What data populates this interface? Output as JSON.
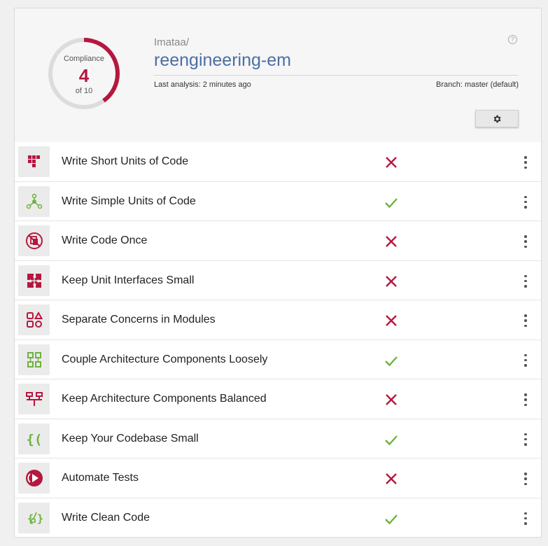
{
  "colors": {
    "fail": "#b5173f",
    "pass": "#6cb33e",
    "repo": "#4a6fa5"
  },
  "compliance": {
    "title": "Compliance",
    "value": "4",
    "of": "of 10",
    "fraction": 0.4
  },
  "repo": {
    "owner": "Imataa/",
    "name": "reengineering-em",
    "last_analysis": "Last analysis: 2 minutes ago",
    "branch": "Branch: master (default)",
    "help_glyph": "?"
  },
  "settings_button": {
    "icon": "gear-icon"
  },
  "guidelines": [
    {
      "label": "Write Short Units of Code",
      "icon": "short-units-icon",
      "status": "fail"
    },
    {
      "label": "Write Simple Units of Code",
      "icon": "simple-units-icon",
      "status": "pass"
    },
    {
      "label": "Write Code Once",
      "icon": "code-once-icon",
      "status": "fail"
    },
    {
      "label": "Keep Unit Interfaces Small",
      "icon": "puzzle-icon",
      "status": "fail"
    },
    {
      "label": "Separate Concerns in Modules",
      "icon": "modules-icon",
      "status": "fail"
    },
    {
      "label": "Couple Architecture Components Loosely",
      "icon": "loose-components-icon",
      "status": "pass"
    },
    {
      "label": "Keep Architecture Components Balanced",
      "icon": "balanced-components-icon",
      "status": "fail"
    },
    {
      "label": "Keep Your Codebase Small",
      "icon": "braces-icon",
      "status": "pass"
    },
    {
      "label": "Automate Tests",
      "icon": "play-icon",
      "status": "fail"
    },
    {
      "label": "Write Clean Code",
      "icon": "broom-icon",
      "status": "pass"
    }
  ]
}
